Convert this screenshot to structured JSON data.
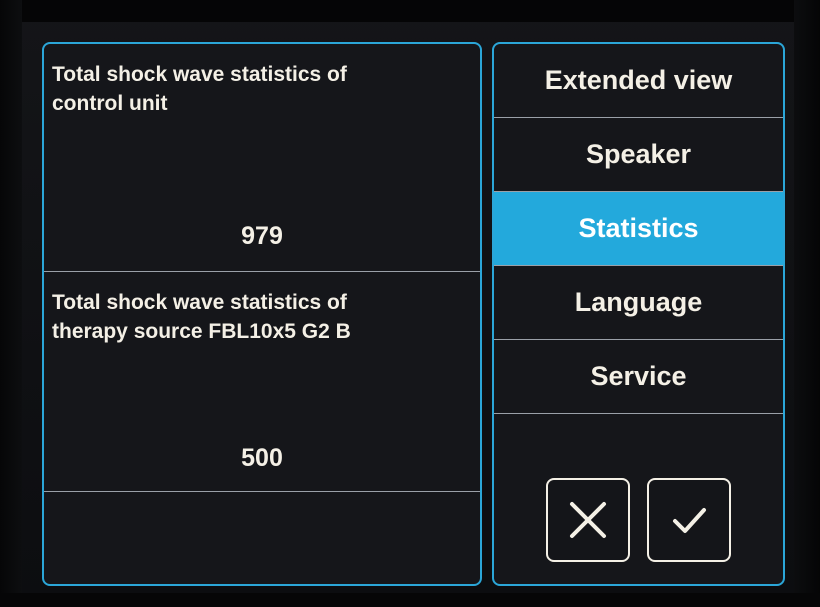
{
  "statistics": {
    "blocks": [
      {
        "title": "Total shock wave statistics of control unit",
        "value": "979"
      },
      {
        "title": "Total shock wave statistics of therapy source FBL10x5 G2 B",
        "value": "500"
      }
    ]
  },
  "menu": {
    "items": [
      {
        "label": "Extended view"
      },
      {
        "label": "Speaker"
      },
      {
        "label": "Statistics"
      },
      {
        "label": "Language"
      },
      {
        "label": "Service"
      }
    ],
    "active_index": 2
  },
  "actions": {
    "cancel_icon": "close-icon",
    "confirm_icon": "check-icon"
  },
  "colors": {
    "accent": "#23a9dc",
    "border": "#2ba6d8",
    "text": "#f4f0e6",
    "panel_bg": "#15161a"
  }
}
